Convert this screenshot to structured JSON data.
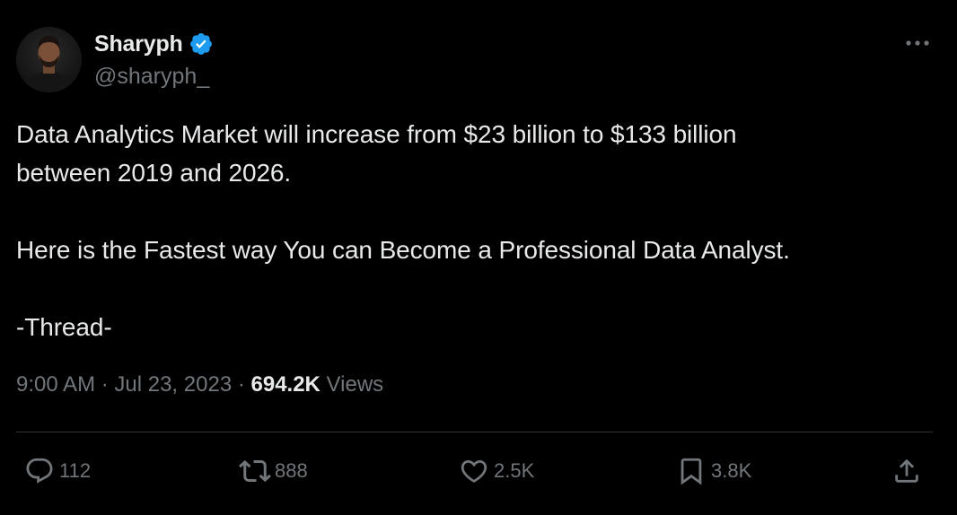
{
  "author": {
    "display_name": "Sharyph",
    "handle": "@sharyph_",
    "verified_icon": "verified-badge-icon",
    "verified_color": "#1d9bf0"
  },
  "tweet": {
    "line1": "Data Analytics Market will increase from $23 billion to $133 billion",
    "line2": "between 2019 and 2026.",
    "line3": "Here is the Fastest way You can Become a Professional Data Analyst.",
    "line4": "-Thread-"
  },
  "meta": {
    "time": "9:00 AM",
    "separator1": " · ",
    "date": "Jul 23, 2023",
    "separator2": " · ",
    "views_count": "694.2K",
    "views_label": " Views"
  },
  "actions": {
    "replies": "112",
    "reposts": "888",
    "likes": "2.5K",
    "bookmarks": "3.8K"
  },
  "colors": {
    "background": "#000000",
    "text_primary": "#e7e9ea",
    "text_secondary": "#71767b",
    "divider": "#2f3336"
  }
}
